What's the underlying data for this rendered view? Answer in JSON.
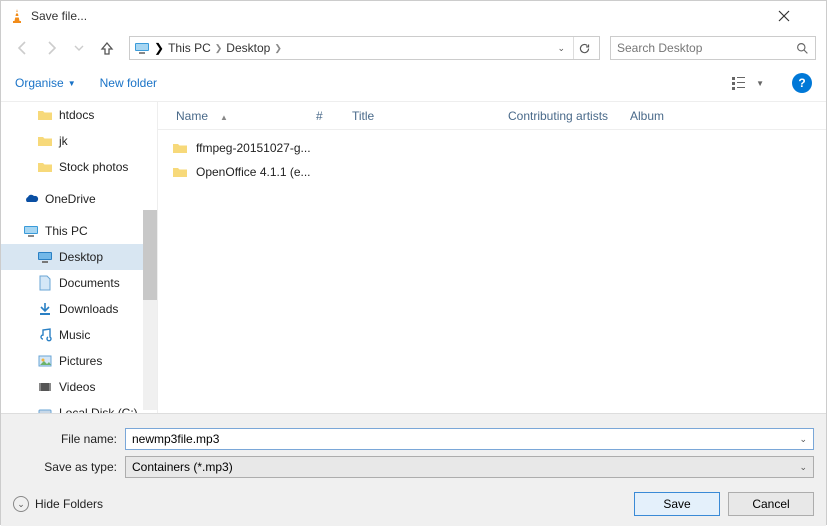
{
  "title": "Save file...",
  "nav": {
    "up_enabled": true
  },
  "breadcrumb": {
    "root": "This PC",
    "path": "Desktop"
  },
  "search": {
    "placeholder": "Search Desktop"
  },
  "toolbar": {
    "organise": "Organise",
    "new_folder": "New folder"
  },
  "columns": {
    "name": "Name",
    "number": "#",
    "title": "Title",
    "contrib": "Contributing artists",
    "album": "Album"
  },
  "files": [
    {
      "name": "ffmpeg-20151027-g..."
    },
    {
      "name": "OpenOffice 4.1.1 (e..."
    }
  ],
  "tree": {
    "htdocs": "htdocs",
    "jk": "jk",
    "stock": "Stock photos",
    "onedrive": "OneDrive",
    "thispc": "This PC",
    "desktop": "Desktop",
    "documents": "Documents",
    "downloads": "Downloads",
    "music": "Music",
    "pictures": "Pictures",
    "videos": "Videos",
    "localdisk": "Local Disk (C:)"
  },
  "form": {
    "filename_label": "File name:",
    "filename_value": "newmp3file.mp3",
    "saveas_label": "Save as type:",
    "saveas_value": "Containers (*.mp3)"
  },
  "buttons": {
    "hide": "Hide Folders",
    "save": "Save",
    "cancel": "Cancel"
  }
}
